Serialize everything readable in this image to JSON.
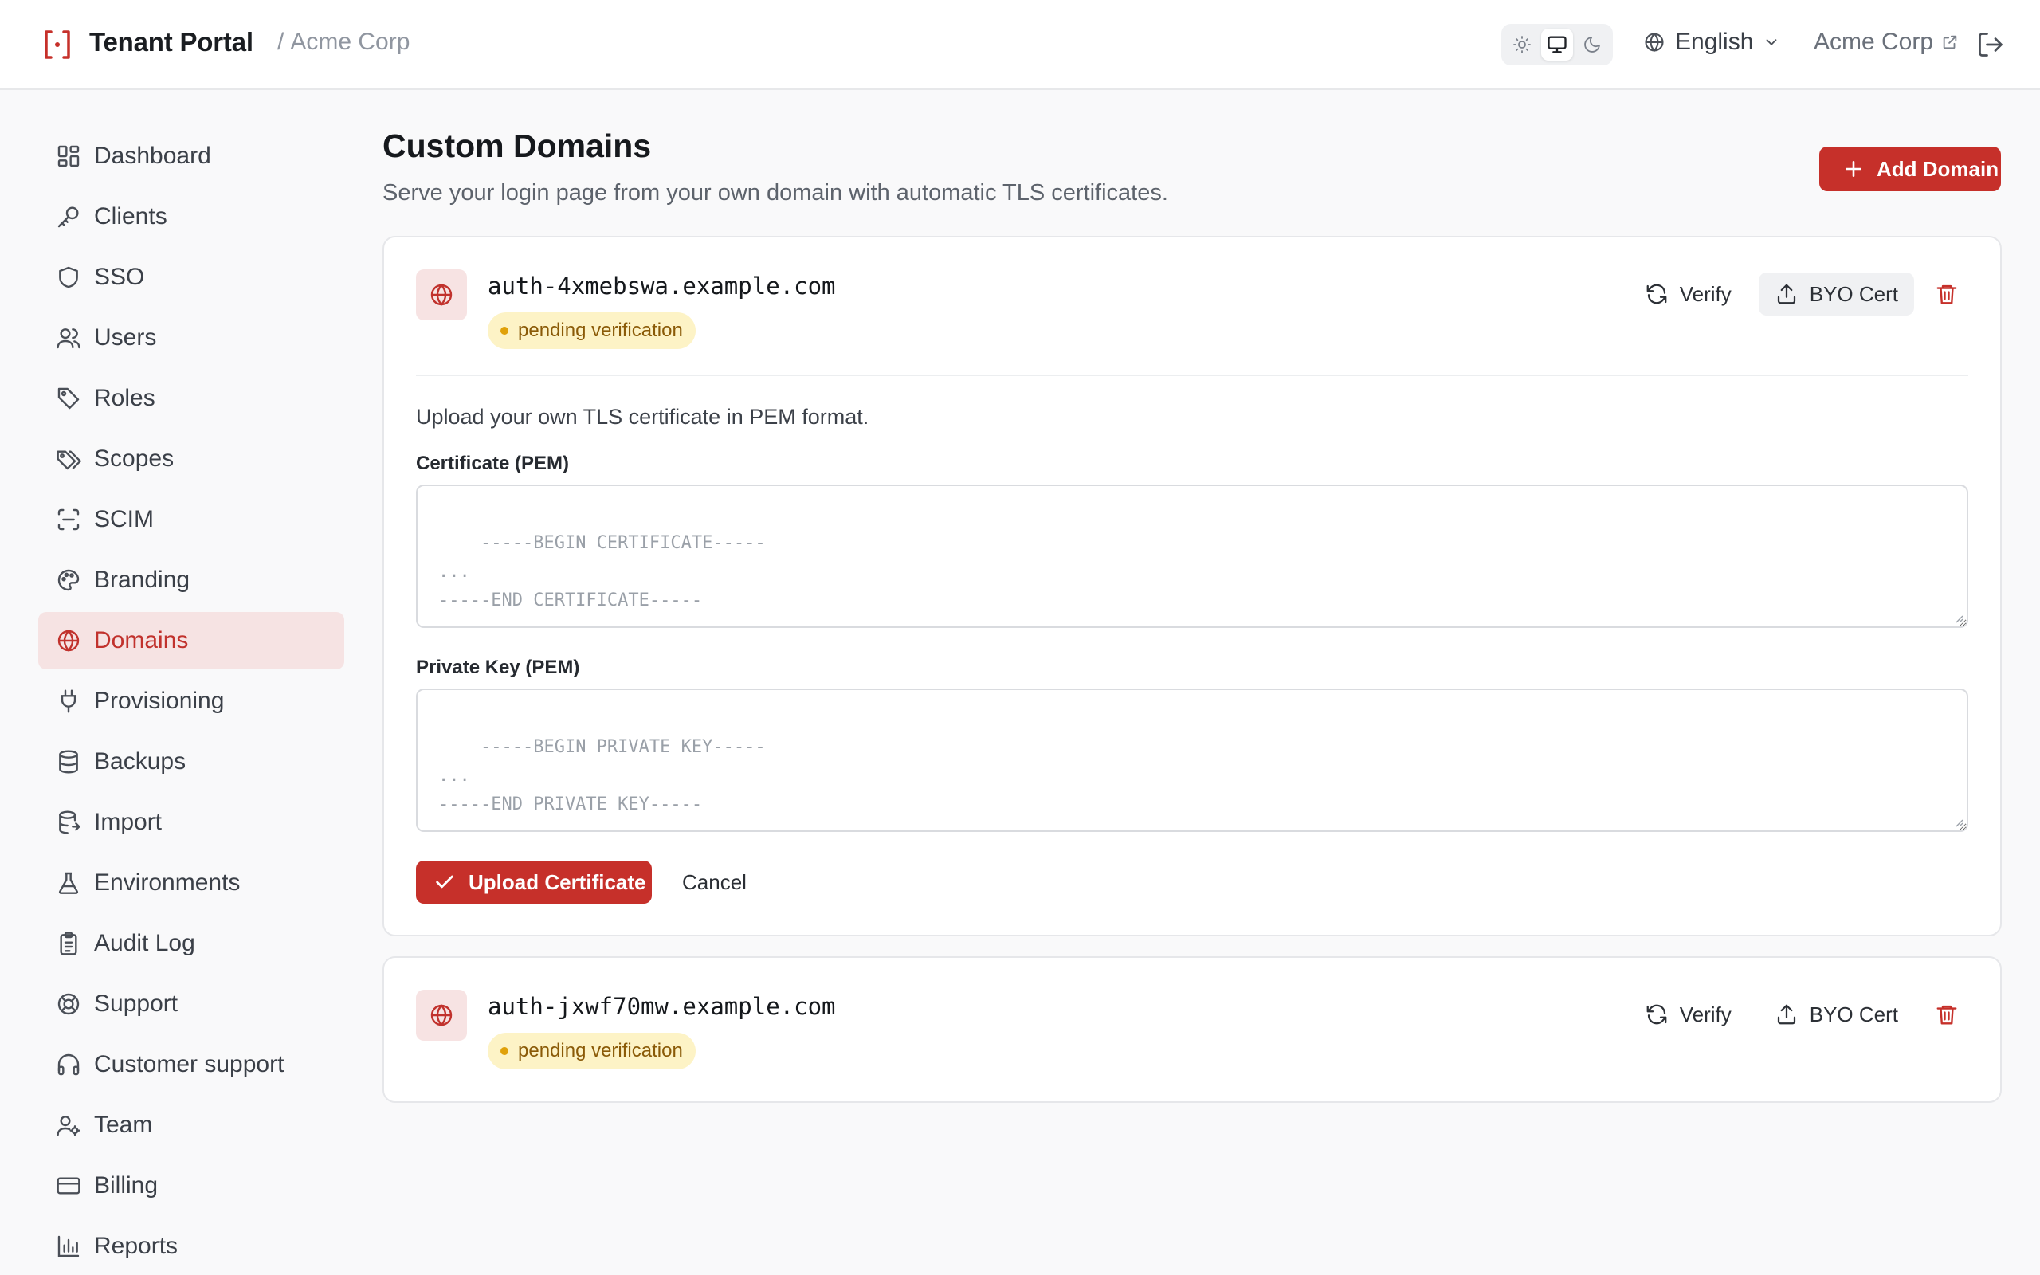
{
  "header": {
    "title": "Tenant Portal",
    "breadcrumb_sep": "/",
    "breadcrumb_org": "Acme Corp",
    "language": "English",
    "tenant_link": "Acme Corp",
    "theme_options": [
      "light",
      "system",
      "dark"
    ],
    "theme_selected": "system"
  },
  "sidebar": {
    "items": [
      {
        "label": "Dashboard",
        "icon": "dashboard-icon"
      },
      {
        "label": "Clients",
        "icon": "key-icon"
      },
      {
        "label": "SSO",
        "icon": "shield-icon"
      },
      {
        "label": "Users",
        "icon": "users-icon"
      },
      {
        "label": "Roles",
        "icon": "tag-icon"
      },
      {
        "label": "Scopes",
        "icon": "tags-icon"
      },
      {
        "label": "SCIM",
        "icon": "scan-icon"
      },
      {
        "label": "Branding",
        "icon": "palette-icon"
      },
      {
        "label": "Domains",
        "icon": "globe-icon",
        "active": true
      },
      {
        "label": "Provisioning",
        "icon": "plug-icon"
      },
      {
        "label": "Backups",
        "icon": "database-icon"
      },
      {
        "label": "Import",
        "icon": "database-import-icon"
      },
      {
        "label": "Environments",
        "icon": "flask-icon"
      },
      {
        "label": "Audit Log",
        "icon": "clipboard-icon"
      },
      {
        "label": "Support",
        "icon": "lifebuoy-icon"
      },
      {
        "label": "Customer support",
        "icon": "headphones-icon"
      },
      {
        "label": "Team",
        "icon": "user-cog-icon"
      },
      {
        "label": "Billing",
        "icon": "credit-card-icon"
      },
      {
        "label": "Reports",
        "icon": "bar-chart-icon"
      }
    ]
  },
  "main": {
    "title": "Custom Domains",
    "subtitle": "Serve your login page from your own domain with automatic TLS certificates.",
    "add_button": "Add Domain",
    "domains": [
      {
        "name": "auth-4xmebswa.example.com",
        "status": "pending verification",
        "verify_label": "Verify",
        "byo_label": "BYO Cert",
        "expanded": true,
        "upload_hint": "Upload your own TLS certificate in PEM format.",
        "cert_label": "Certificate (PEM)",
        "cert_placeholder": "-----BEGIN CERTIFICATE-----\n...\n-----END CERTIFICATE-----",
        "key_label": "Private Key (PEM)",
        "key_placeholder": "-----BEGIN PRIVATE KEY-----\n...\n-----END PRIVATE KEY-----",
        "upload_button": "Upload Certificate",
        "cancel_button": "Cancel"
      },
      {
        "name": "auth-jxwf70mw.example.com",
        "status": "pending verification",
        "verify_label": "Verify",
        "byo_label": "BYO Cert",
        "expanded": false
      }
    ]
  },
  "colors": {
    "accent": "#c6302a",
    "active_nav_bg": "#f6e3e3",
    "pending_bg": "#fdf3c6",
    "pending_dot": "#e0a10a"
  }
}
